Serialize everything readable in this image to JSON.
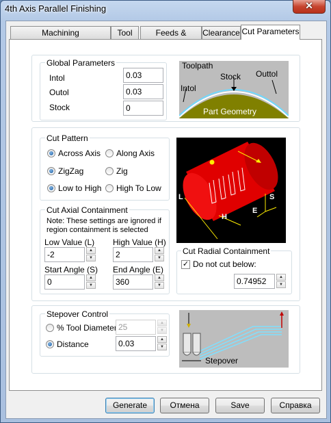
{
  "window": {
    "title": "4th Axis Parallel Finishing",
    "close_glyph": "✕"
  },
  "tabs": [
    {
      "label": "Machining Features/Regions"
    },
    {
      "label": "Tool"
    },
    {
      "label": "Feeds & Speeds"
    },
    {
      "label": "Clearance"
    },
    {
      "label": "Cut Parameters",
      "active": true
    }
  ],
  "global_params": {
    "title": "Global Parameters",
    "intol_label": "Intol",
    "intol_value": "0.03",
    "outol_label": "Outol",
    "outol_value": "0.03",
    "stock_label": "Stock",
    "stock_value": "0"
  },
  "tol_diagram": {
    "toolpath": "Toolpath",
    "stock": "Stock",
    "outtol": "Outtol",
    "intol": "Intol",
    "part_geometry": "Part Geometry"
  },
  "cut_pattern": {
    "title": "Cut Pattern",
    "across_axis": "Across Axis",
    "along_axis": "Along Axis",
    "zigzag": "ZigZag",
    "zig": "Zig",
    "low_to_high": "Low to High",
    "high_to_low": "High To Low",
    "selected": [
      "Across Axis",
      "ZigZag",
      "Low to High"
    ]
  },
  "axial": {
    "title": "Cut Axial Containment",
    "note": "Note:  These settings are ignored if region containment is selected",
    "low_label": "Low Value (L)",
    "low_value": "-2",
    "high_label": "High Value (H)",
    "high_value": "2",
    "start_label": "Start Angle (S)",
    "start_value": "0",
    "end_label": "End Angle (E)",
    "end_value": "360"
  },
  "cyl_diagram": {
    "l": "L",
    "h": "H",
    "s": "S",
    "e": "E"
  },
  "radial": {
    "title": "Cut Radial Containment",
    "check_label": "Do not cut below:",
    "checked": true,
    "value": "0.74952"
  },
  "stepover": {
    "title": "Stepover Control",
    "tool_diameter_label": "% Tool Diameter",
    "tool_diameter_value": "25",
    "distance_label": "Distance",
    "distance_value": "0.03",
    "selected": "Distance",
    "diagram_label": "Stepover"
  },
  "buttons": {
    "generate": "Generate",
    "cancel": "Отмена",
    "save": "Save",
    "help": "Справка"
  },
  "colors": {
    "part": "#808000",
    "cylinder": "#e00000",
    "stock_line": "#ffffff",
    "toolpath": "#7fe0ff"
  }
}
